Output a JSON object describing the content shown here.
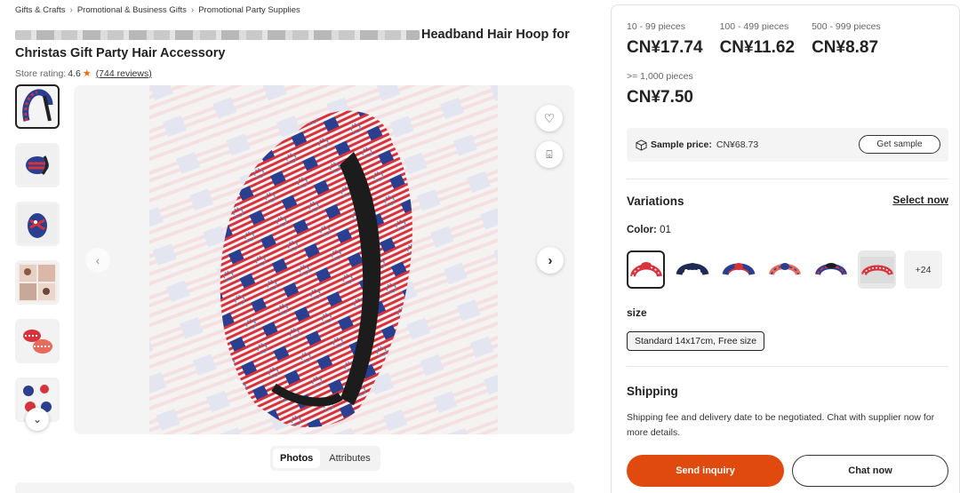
{
  "breadcrumb": [
    "Gifts & Crafts",
    "Promotional & Business Gifts",
    "Promotional Party Supplies"
  ],
  "product": {
    "title_visible": "Headband Hair Hoop for Christas Gift Party Hair Accessory",
    "rating_label": "Store rating:",
    "rating_value": "4.6",
    "reviews": "(744 reviews)"
  },
  "gallery": {
    "thumbnail_count": 6,
    "tabs": [
      "Photos",
      "Attributes"
    ],
    "active_tab": "Photos"
  },
  "pricing": {
    "tiers": [
      {
        "range": "10 - 99 pieces",
        "price": "CN¥17.74"
      },
      {
        "range": "100 - 499 pieces",
        "price": "CN¥11.62"
      },
      {
        "range": "500 - 999 pieces",
        "price": "CN¥8.87"
      },
      {
        "range": ">= 1,000 pieces",
        "price": "CN¥7.50"
      }
    ],
    "sample_label": "Sample price:",
    "sample_value": "CN¥68.73",
    "sample_button": "Get sample"
  },
  "variations": {
    "title": "Variations",
    "select_now": "Select now",
    "color_label": "Color:",
    "color_value": "01",
    "more_label": "+24",
    "size_title": "size",
    "size_option": "Standard 14x17cm, Free size"
  },
  "shipping": {
    "title": "Shipping",
    "text": "Shipping fee and delivery date to be negotiated. Chat with supplier now for more details."
  },
  "actions": {
    "inquiry": "Send inquiry",
    "chat": "Chat now"
  },
  "colors": {
    "accent": "#e04a0f",
    "flag_red": "#d8323c",
    "flag_blue": "#2a3f8f",
    "firework_blue": "#3a9ad9"
  },
  "icons": [
    "chevron-right-icon",
    "star-icon",
    "heart-icon",
    "scan-icon",
    "chevron-left-icon",
    "chevron-down-icon",
    "box-icon"
  ]
}
